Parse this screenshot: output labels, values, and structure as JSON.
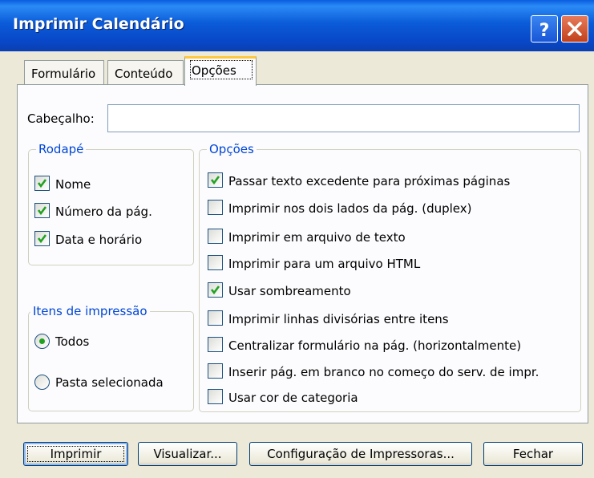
{
  "window": {
    "title": "Imprimir Calendário",
    "help": "?",
    "close": "×"
  },
  "tabs": [
    {
      "label": "Formulário"
    },
    {
      "label": "Conteúdo"
    },
    {
      "label": "Opções"
    }
  ],
  "header": {
    "label": "Cabeçalho:",
    "value": ""
  },
  "footer_group": {
    "title": "Rodapé",
    "items": [
      {
        "label": "Nome",
        "checked": true
      },
      {
        "label": "Número da pág.",
        "checked": true
      },
      {
        "label": "Data e horário",
        "checked": true
      }
    ]
  },
  "print_items_group": {
    "title": "Itens de impressão",
    "options": [
      {
        "label": "Todos",
        "selected": true
      },
      {
        "label": "Pasta selecionada",
        "selected": false
      }
    ]
  },
  "options_group": {
    "title": "Opções",
    "items": [
      {
        "label": "Passar texto excedente para próximas páginas",
        "checked": true
      },
      {
        "label": "Imprimir nos dois lados da pág. (duplex)",
        "checked": false
      },
      {
        "label": "Imprimir em arquivo de texto",
        "checked": false
      },
      {
        "label": "Imprimir para um arquivo HTML",
        "checked": false
      },
      {
        "label": "Usar sombreamento",
        "checked": true
      },
      {
        "label": "Imprimir linhas divisórias entre itens",
        "checked": false
      },
      {
        "label": "Centralizar formulário na pág. (horizontalmente)",
        "checked": false
      },
      {
        "label": "Inserir pág. em branco no começo do serv. de impr.",
        "checked": false
      },
      {
        "label": "Usar cor de categoria",
        "checked": false
      }
    ]
  },
  "buttons": {
    "print": "Imprimir",
    "preview": "Visualizar...",
    "printer_setup": "Configuração de Impressoras...",
    "close": "Fechar"
  },
  "colors": {
    "titlebar": "#0a5ce0",
    "group_title": "#0046d5",
    "tab_highlight": "#ffc73c",
    "check": "#21a121"
  }
}
